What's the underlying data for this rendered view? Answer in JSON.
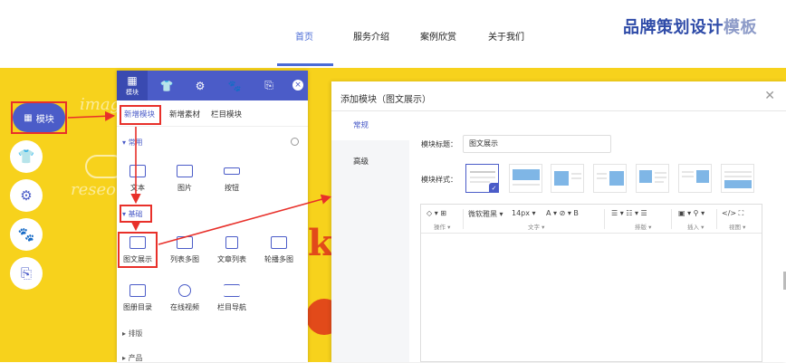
{
  "nav": {
    "items": [
      {
        "label": "首页",
        "active": true
      },
      {
        "label": "服务介绍",
        "active": false
      },
      {
        "label": "案例欣赏",
        "active": false
      },
      {
        "label": "关于我们",
        "active": false
      }
    ]
  },
  "brand": {
    "main": "品牌策划设计",
    "muted": "模板"
  },
  "stage": {
    "deco1": "imag",
    "deco2": "reseo",
    "deco3": "k"
  },
  "toolbar": {
    "module_label": "模块",
    "items": [
      "shirt-icon",
      "gear-icon",
      "paw-icon",
      "stamp-icon"
    ]
  },
  "panel": {
    "tabs": [
      {
        "icon": "grid-icon",
        "label": "模块",
        "active": true
      },
      {
        "icon": "shirt-icon",
        "label": ""
      },
      {
        "icon": "gear-icon",
        "label": ""
      },
      {
        "icon": "paw-icon",
        "label": ""
      },
      {
        "icon": "stamp-icon",
        "label": ""
      }
    ],
    "close": "×",
    "subtabs": [
      "新增模块",
      "新增素材",
      "栏目模块"
    ],
    "section_common": "常用",
    "common_modules": [
      "文本",
      "图片",
      "按钮"
    ],
    "section_basic": "基础",
    "basic_modules": [
      "图文展示",
      "列表多图",
      "文章列表",
      "轮播多图",
      "图册目录",
      "在线视频",
      "栏目导航"
    ],
    "section_layout": "排版",
    "section_product": "产品"
  },
  "dialog": {
    "title": "添加模块（图文展示）",
    "close": "✕",
    "side": [
      "常规",
      "高级"
    ],
    "label_title": "模块标题：",
    "title_value": "图文展示",
    "label_style": "模块样式：",
    "style_count": 8,
    "editor": {
      "b1": "◇ ▾ ⊞",
      "g1": "操作 ▾",
      "font": "微软雅黑 ▾",
      "size": "14px ▾",
      "fmt": "A ▾  ⊘ ▾  B",
      "g2": "文字 ▾",
      "para": "☰ ▾  ☷ ▾  ☰",
      "g3": "排版 ▾",
      "ins": "▣ ▾  ⚲ ▾",
      "g4": "插入 ▾",
      "view": "</>  ⛶",
      "g5": "视图 ▾"
    }
  },
  "colors": {
    "accent": "#4b5cc8",
    "stage": "#f7d21c",
    "annot": "#e8302a"
  }
}
